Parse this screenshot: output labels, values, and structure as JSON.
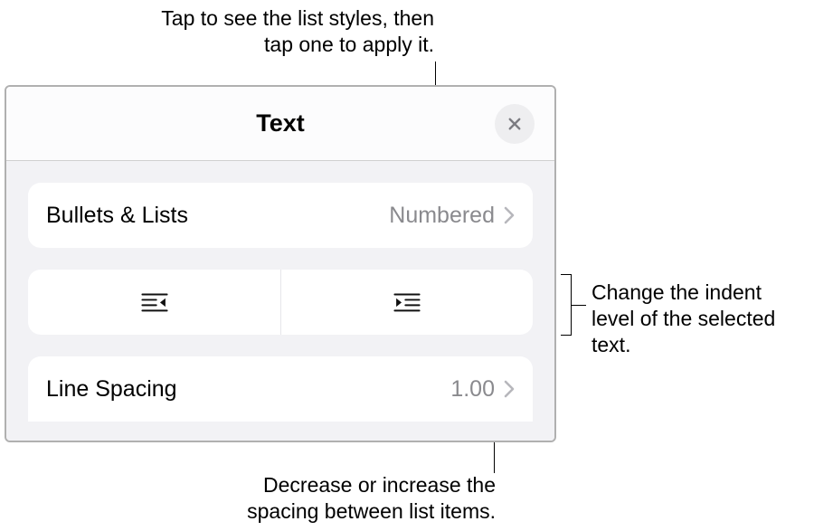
{
  "callouts": {
    "top": "Tap to see the list styles, then tap one to apply it.",
    "right": "Change the indent level of the selected text.",
    "bottom": "Decrease or increase the spacing between list items."
  },
  "panel": {
    "title": "Text",
    "bullets_label": "Bullets & Lists",
    "bullets_value": "Numbered",
    "line_spacing_label": "Line Spacing",
    "line_spacing_value": "1.00"
  }
}
